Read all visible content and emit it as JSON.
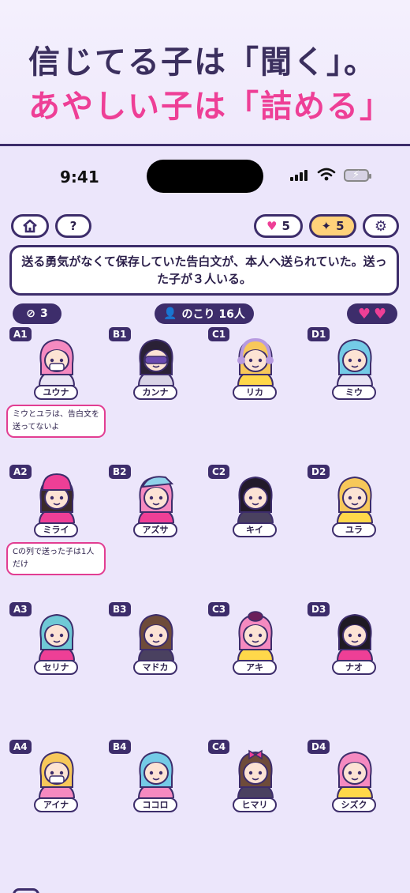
{
  "promo": {
    "line1": "信じてる子は「聞く」。",
    "line2": "あやしい子は「詰める」"
  },
  "status": {
    "time": "9:41"
  },
  "toolbar": {
    "home_icon": "home-icon",
    "help_label": "?",
    "hearts_count": "5",
    "sparkles_count": "5",
    "settings_icon": "gear-icon"
  },
  "prompt": {
    "text": "送る勇気がなくて保存していた告白文が、本人へ送られていた。送った子が３人いる。"
  },
  "stats": {
    "accused_count": "3",
    "remaining_label": "のこり 16人",
    "lives": 2
  },
  "colors": {
    "accent_pink": "#ee3f96",
    "dark_purple": "#3d2d6b",
    "background": "#ece6fb",
    "gold": "#ffd27a"
  },
  "characters": [
    {
      "coord": "A1",
      "name": "ユウナ",
      "hair": "#f58ac0",
      "shirt": "#e8e3f4",
      "accessory": "mask"
    },
    {
      "coord": "B1",
      "name": "カンナ",
      "hair": "#2a2136",
      "shirt": "#d9d4e6",
      "accessory": "visor"
    },
    {
      "coord": "C1",
      "name": "リカ",
      "hair": "#f7c85a",
      "shirt": "#ffd84a",
      "accessory": "headphones"
    },
    {
      "coord": "D1",
      "name": "ミウ",
      "hair": "#74cbe6",
      "shirt": "#e8e3f4",
      "accessory": "none"
    },
    {
      "coord": "A2",
      "name": "ミライ",
      "hair": "#3a2a2a",
      "shirt": "#ee3f96",
      "accessory": "beanie"
    },
    {
      "coord": "B2",
      "name": "アズサ",
      "hair": "#f58ac0",
      "shirt": "#ee3f96",
      "accessory": "cap"
    },
    {
      "coord": "C2",
      "name": "キイ",
      "hair": "#221a2a",
      "shirt": "#4a4160",
      "accessory": "none"
    },
    {
      "coord": "D2",
      "name": "ユラ",
      "hair": "#f7c85a",
      "shirt": "#ffd84a",
      "accessory": "none"
    },
    {
      "coord": "A3",
      "name": "セリナ",
      "hair": "#6fc9d6",
      "shirt": "#ee3f96",
      "accessory": "none"
    },
    {
      "coord": "B3",
      "name": "マドカ",
      "hair": "#6e4b3a",
      "shirt": "#4a4160",
      "accessory": "none"
    },
    {
      "coord": "C3",
      "name": "アキ",
      "hair": "#f58ac0",
      "shirt": "#ffd84a",
      "accessory": "hat"
    },
    {
      "coord": "D3",
      "name": "ナオ",
      "hair": "#1f1a24",
      "shirt": "#ee3f96",
      "accessory": "none"
    },
    {
      "coord": "A4",
      "name": "アイナ",
      "hair": "#f7c85a",
      "shirt": "#f58ac0",
      "accessory": "mask"
    },
    {
      "coord": "B4",
      "name": "ココロ",
      "hair": "#74cbe6",
      "shirt": "#f58ac0",
      "accessory": "none"
    },
    {
      "coord": "C4",
      "name": "ヒマリ",
      "hair": "#6e4b3a",
      "shirt": "#4a4160",
      "accessory": "bow"
    },
    {
      "coord": "D4",
      "name": "シズク",
      "hair": "#f58ac0",
      "shirt": "#ffd84a",
      "accessory": "none"
    }
  ],
  "hints": [
    {
      "coord": "A1",
      "text": "ミウとユラは、告白文を送ってないよ"
    },
    {
      "coord": "A2",
      "text": "Cの列で送った子は1人だけ"
    }
  ]
}
